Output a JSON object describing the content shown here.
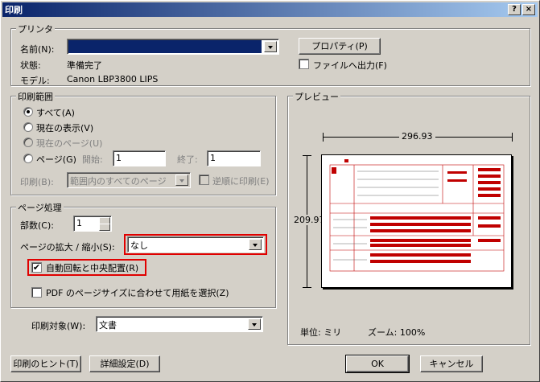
{
  "title": "印刷",
  "title_buttons": {
    "help": "?",
    "close": "×"
  },
  "printer": {
    "group": "プリンタ",
    "name_label": "名前(N):",
    "name_value": "",
    "properties_button": "プロパティ(P)",
    "status_label": "状態:",
    "status_value": "準備完了",
    "model_label": "モデル:",
    "model_value": "Canon LBP3800 LIPS",
    "print_to_file": "ファイルへ出力(F)"
  },
  "range": {
    "group": "印刷範囲",
    "all": "すべて(A)",
    "current_view": "現在の表示(V)",
    "current_page": "現在のページ(U)",
    "pages": "ページ(G)",
    "from_label": "開始:",
    "from_value": "1",
    "to_label": "終了:",
    "to_value": "1",
    "print_label": "印刷(B):",
    "print_value": "範囲内のすべてのページ",
    "reverse": "逆順に印刷(E)"
  },
  "page_handling": {
    "group": "ページ処理",
    "copies_label": "部数(C):",
    "copies_value": "1",
    "scaling_label": "ページの拡大 / 縮小(S):",
    "scaling_value": "なし",
    "auto_rotate": "自動回転と中央配置(R)",
    "pdf_size": "PDF のページサイズに合わせて用紙を選択(Z)"
  },
  "print_what": {
    "label": "印刷対象(W):",
    "value": "文書"
  },
  "preview": {
    "group": "プレビュー",
    "width": "296.93",
    "height": "209.97",
    "units": "単位: ミリ",
    "zoom": "ズーム: 100%"
  },
  "footer": {
    "hint": "印刷のヒント(T)",
    "advanced": "詳細設定(D)",
    "ok": "OK",
    "cancel": "キャンセル"
  }
}
